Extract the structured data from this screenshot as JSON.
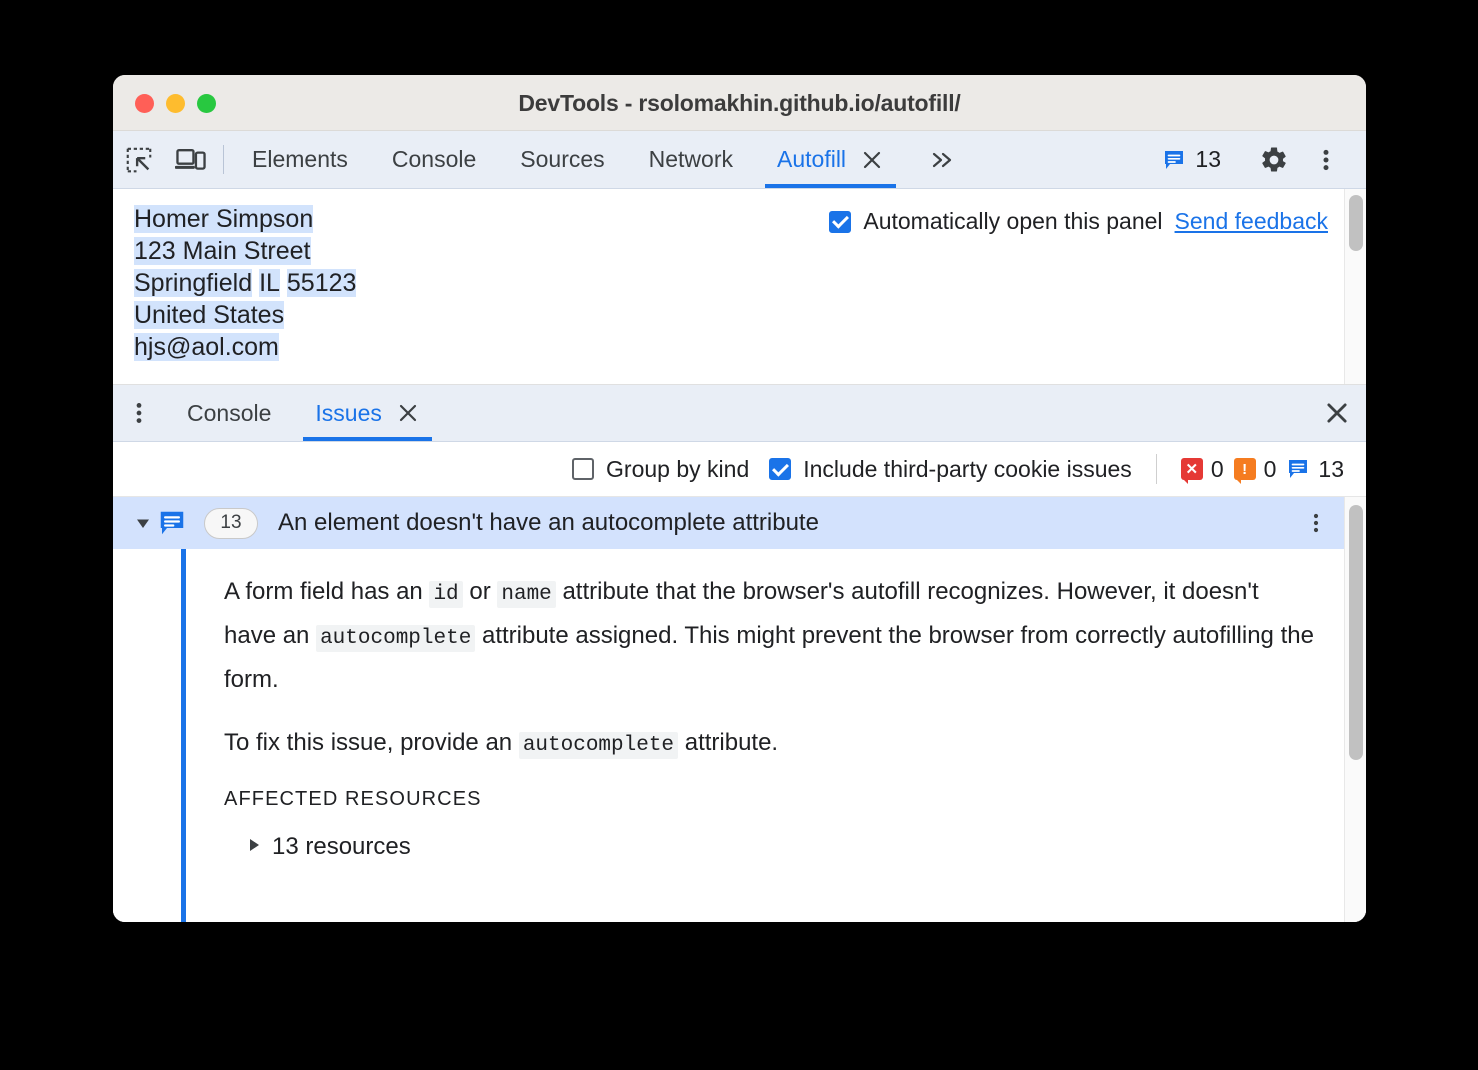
{
  "window": {
    "title": "DevTools - rsolomakhin.github.io/autofill/",
    "traffic_lights": [
      "close",
      "minimize",
      "zoom"
    ]
  },
  "main_toolbar": {
    "inspect_icon": "inspect-element-icon",
    "device_icon": "device-toolbar-icon",
    "tabs": [
      {
        "label": "Elements",
        "active": false,
        "closable": false
      },
      {
        "label": "Console",
        "active": false,
        "closable": false
      },
      {
        "label": "Sources",
        "active": false,
        "closable": false
      },
      {
        "label": "Network",
        "active": false,
        "closable": false
      },
      {
        "label": "Autofill",
        "active": true,
        "closable": true
      }
    ],
    "more_tabs_label": "»",
    "issues_count": "13",
    "settings_icon": "gear-icon",
    "more_icon": "kebab-menu-icon"
  },
  "autofill": {
    "address_lines": [
      [
        {
          "text": "Homer Simpson",
          "highlight": true
        }
      ],
      [
        {
          "text": "123 Main Street",
          "highlight": true
        }
      ],
      [
        {
          "text": "Springfield",
          "highlight": true
        },
        {
          "text": " ",
          "highlight": false
        },
        {
          "text": "IL",
          "highlight": true
        },
        {
          "text": " ",
          "highlight": false
        },
        {
          "text": "55123",
          "highlight": true
        }
      ],
      [
        {
          "text": "United States",
          "highlight": true
        }
      ],
      [
        {
          "text": "hjs@aol.com",
          "highlight": true
        }
      ]
    ],
    "auto_open_label": "Automatically open this panel",
    "auto_open_checked": true,
    "feedback_label": "Send feedback"
  },
  "drawer": {
    "tabs": [
      {
        "label": "Console",
        "active": false,
        "closable": false
      },
      {
        "label": "Issues",
        "active": true,
        "closable": true
      }
    ],
    "close_label": "×"
  },
  "issues_toolbar": {
    "group_by_kind_label": "Group by kind",
    "group_by_kind_checked": false,
    "third_party_label": "Include third-party cookie issues",
    "third_party_checked": true,
    "counts": [
      {
        "kind": "error",
        "icon": "error-badge-icon",
        "value": "0",
        "color": "#e53935"
      },
      {
        "kind": "warning",
        "icon": "warning-badge-icon",
        "value": "0",
        "color": "#f57c20"
      },
      {
        "kind": "info",
        "icon": "info-badge-icon",
        "value": "13",
        "color": "#1a73e8"
      }
    ]
  },
  "issue": {
    "expanded": true,
    "icon": "issue-info-icon",
    "count": "13",
    "title": "An element doesn't have an autocomplete attribute",
    "paragraph1": {
      "part1": "A form field has an ",
      "code1": "id",
      "part2": " or ",
      "code2": "name",
      "part3": " attribute that the browser's autofill recognizes. However, it doesn't have an ",
      "code3": "autocomplete",
      "part4": " attribute assigned. This might prevent the browser from correctly autofilling the form."
    },
    "paragraph2": {
      "part1": "To fix this issue, provide an ",
      "code1": "autocomplete",
      "part2": " attribute."
    },
    "affected_resources_label": "AFFECTED RESOURCES",
    "resources_label": "13 resources",
    "resources_expanded": false
  },
  "colors": {
    "accent": "#1a73e8",
    "toolbar_bg": "#e9eef6",
    "row_highlight": "#d3e2fd",
    "text_highlight": "#d2e3fc",
    "titlebar_bg": "#eceae7"
  }
}
